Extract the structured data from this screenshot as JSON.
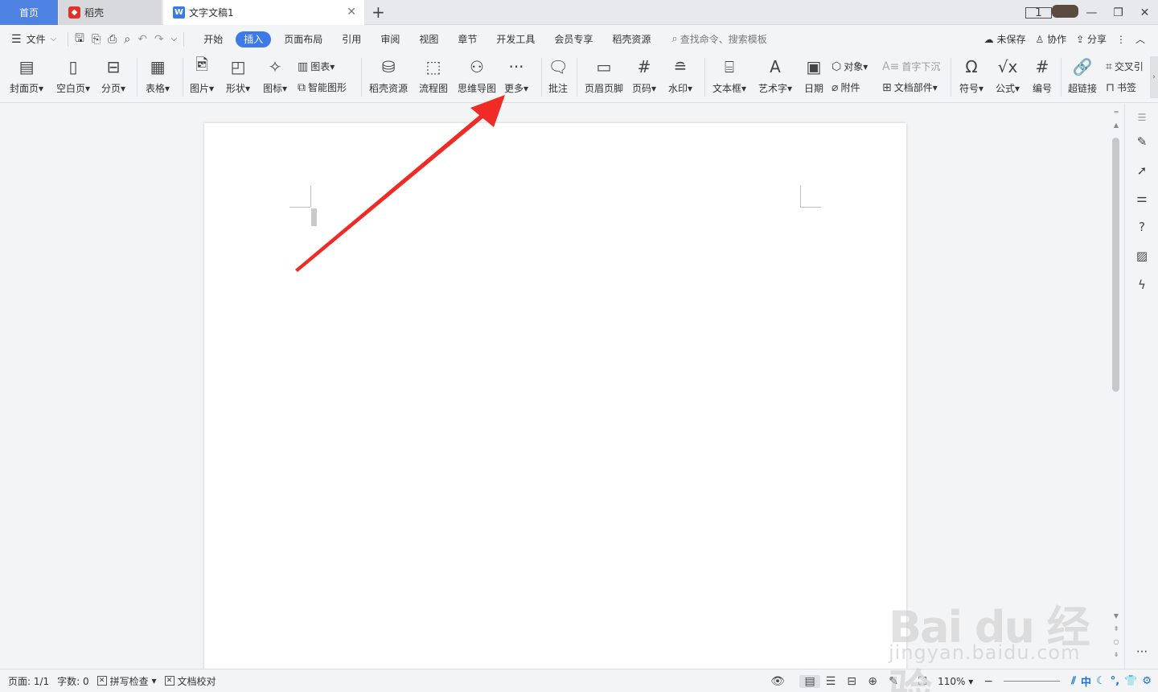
{
  "tabs": {
    "home": "首页",
    "daoke": "稻壳",
    "doc": "文字文稿1"
  },
  "menu": {
    "file": "文件",
    "tabs": [
      "开始",
      "插入",
      "页面布局",
      "引用",
      "审阅",
      "视图",
      "章节",
      "开发工具",
      "会员专享",
      "稻壳资源"
    ],
    "active_tab": "插入",
    "search_placeholder": "查找命令、搜索模板",
    "unsaved": "未保存",
    "collab": "协作",
    "share": "分享"
  },
  "ribbon": {
    "cover": "封面页",
    "blank": "空白页",
    "pagebreak": "分页",
    "table": "表格",
    "picture": "图片",
    "shape": "形状",
    "iconlib": "图标",
    "chart": "图表",
    "smartart": "智能图形",
    "daoke_res": "稻壳资源",
    "flowchart": "流程图",
    "mindmap": "思维导图",
    "more": "更多",
    "comment": "批注",
    "header_footer": "页眉页脚",
    "page_number": "页码",
    "watermark": "水印",
    "textbox": "文本框",
    "wordart": "艺术字",
    "date": "日期",
    "object": "对象",
    "attachment": "附件",
    "dropcap": "首字下沉",
    "docpart": "文档部件",
    "symbol": "符号",
    "formula": "公式",
    "numbering": "编号",
    "hyperlink": "超链接",
    "crossref": "交叉引",
    "bookmark": "书签"
  },
  "status": {
    "page": "页面: 1/1",
    "words": "字数: 0",
    "spellcheck": "拼写检查",
    "proofread": "文档校对",
    "zoom": "110%",
    "ime_lang": "中"
  },
  "watermark": {
    "main": "Bai du 经验",
    "sub": "jingyan.baidu.com"
  },
  "colors": {
    "accent": "#3d7ae8",
    "home_tab": "#4e82e2",
    "arrow": "#f02a25"
  }
}
